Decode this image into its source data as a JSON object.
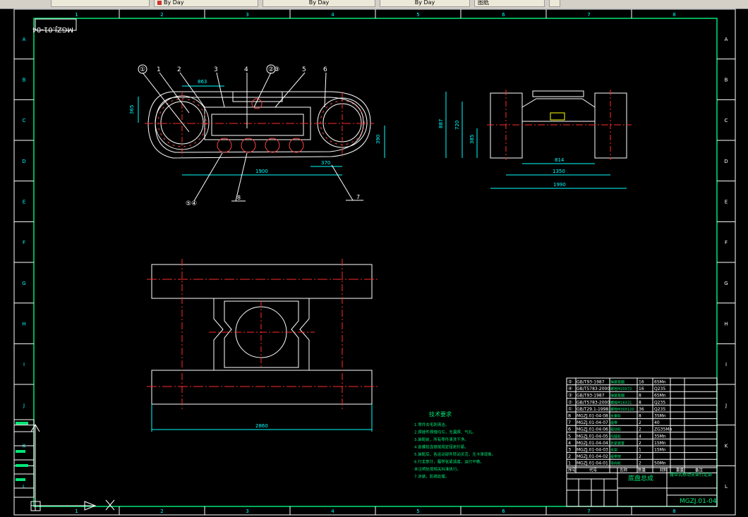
{
  "tabs": [
    {
      "label": "By Day"
    },
    {
      "label": "By Day"
    },
    {
      "label": "By Day"
    },
    {
      "label": "图纸"
    }
  ],
  "border": {
    "columns": [
      "1",
      "2",
      "3",
      "4",
      "5",
      "6",
      "7",
      "8"
    ],
    "rows": [
      "A",
      "B",
      "C",
      "D",
      "E",
      "F",
      "G",
      "H",
      "I",
      "J",
      "K",
      "L"
    ]
  },
  "drawing_code_mirrored": "MGZJ.01-04",
  "side_view": {
    "callouts_top": [
      "①",
      "1",
      "2",
      "3",
      "4",
      "②③",
      "5",
      "6"
    ],
    "callouts_bottom": [
      "⑤④",
      "8",
      "7"
    ],
    "dims": {
      "a": "863",
      "b": "365",
      "c": "1900",
      "d": "370",
      "e": "390"
    }
  },
  "end_view": {
    "dims": {
      "a": "887",
      "b": "720",
      "c": "385",
      "d": "814",
      "e": "1350",
      "f": "1990"
    }
  },
  "top_view": {
    "dims": {
      "a": "2860"
    }
  },
  "notes": {
    "title": "技术要求",
    "lines": [
      "1.零件去毛刺清洁。",
      "2.焊接件焊缝均匀，无漏焊、气孔。",
      "3.装配前，所有零件清洗干净。",
      "4.各螺栓连接按规定扭矩拧紧。",
      "5.装配后，各运动部件转动灵活，无卡滞现象。",
      "6.行走部分，履带张紧适度，运行平稳。",
      "  未注明处按相关标准执行。",
      "7.涂装，防锈处理。"
    ]
  },
  "bom": [
    {
      "no": "⑤",
      "code": "GB/T93-1987",
      "name": "弹簧垫圈",
      "qty": "16",
      "mat": "65Mn"
    },
    {
      "no": "④",
      "code": "GB/T5783-2000",
      "name": "螺栓M20X72",
      "qty": "16",
      "mat": "Q235"
    },
    {
      "no": "③",
      "code": "GB/T93-1987",
      "name": "弹簧垫圈",
      "qty": "8",
      "mat": "65Mn"
    },
    {
      "no": "②",
      "code": "GB/T5783-2000",
      "name": "螺栓M16X31",
      "qty": "8",
      "mat": "Q235"
    },
    {
      "no": "①",
      "code": "GB/T29.1-1998",
      "name": "螺栓M30X120",
      "qty": "36",
      "mat": "Q235"
    },
    {
      "no": "8",
      "code": "MGZJ.01-04-08",
      "name": "支重轮",
      "qty": "8",
      "mat": "35Mn"
    },
    {
      "no": "7",
      "code": "MGZJ.01-04-07",
      "name": "履带",
      "qty": "2",
      "mat": "40"
    },
    {
      "no": "6",
      "code": "MGZJ.01-04-06",
      "name": "驱动轮",
      "qty": "2",
      "mat": "ZG35Mn"
    },
    {
      "no": "5",
      "code": "MGZJ.01-04-05",
      "name": "托链轮",
      "qty": "4",
      "mat": "35Mn"
    },
    {
      "no": "4",
      "code": "MGZJ.01-04-04",
      "name": "张紧装置",
      "qty": "2",
      "mat": "15Mn"
    },
    {
      "no": "3",
      "code": "MGZJ.01-04-03",
      "name": "支架",
      "qty": "1",
      "mat": "15Mn"
    },
    {
      "no": "2",
      "code": "MGZJ.01-04-02",
      "name": "履带架",
      "qty": "2",
      "mat": ""
    },
    {
      "no": "1",
      "code": "MGZJ.01-04-01",
      "name": "导向轮",
      "qty": "2",
      "mat": "50Mn"
    }
  ],
  "bom_header": {
    "no": "序号",
    "code": "代号",
    "name": "名称",
    "qty": "数量",
    "mat": "材料",
    "weight": "重量",
    "remark": "备注"
  },
  "title_block": {
    "part_name": "底盘总成",
    "company": "履带式移动支架行走部",
    "drawing_no": "MGZJ.01-04"
  },
  "colors": {
    "border": "#ffffff",
    "frame": "#00e676",
    "red_center": "#ff2a2a",
    "cyan_dim": "#00ffff",
    "yellow": "#ffff00",
    "white": "#ffffff"
  }
}
